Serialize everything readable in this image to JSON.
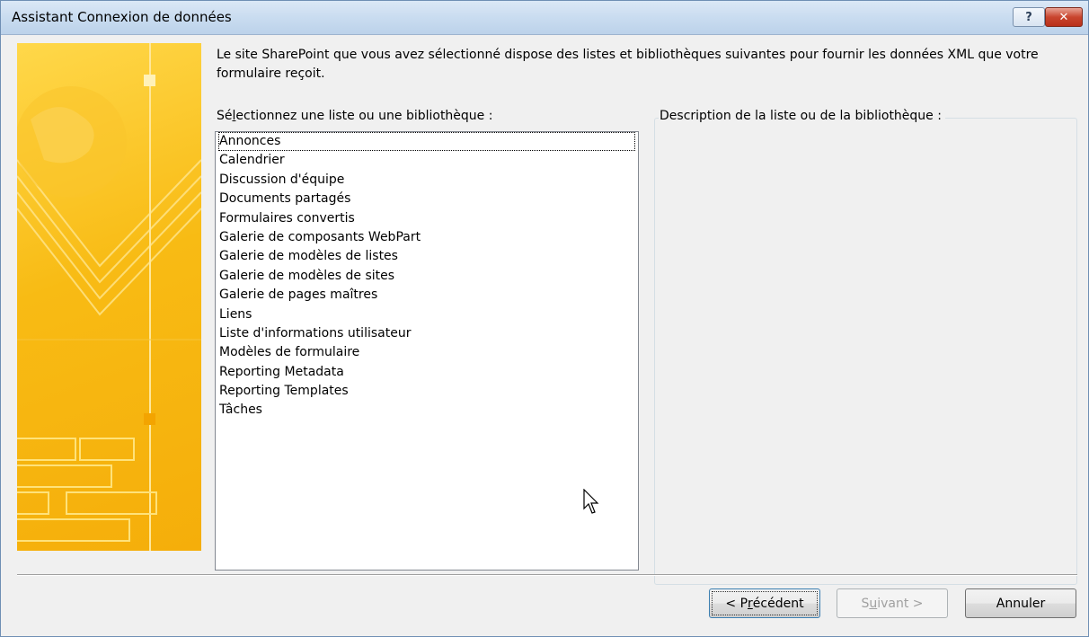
{
  "window": {
    "title": "Assistant Connexion de données",
    "help_label": "?",
    "close_label": "✕"
  },
  "intro_text": "Le site SharePoint que vous avez sélectionné dispose des listes et bibliothèques suivantes pour fournir les données XML que votre formulaire reçoit.",
  "list_section": {
    "label_prefix": "Sé",
    "label_accel": "l",
    "label_suffix": "ectionnez une liste ou une bibliothèque :",
    "items": [
      "Annonces",
      "Calendrier",
      "Discussion d'équipe",
      "Documents partagés",
      "Formulaires convertis",
      "Galerie de composants WebPart",
      "Galerie de modèles de listes",
      "Galerie de modèles de sites",
      "Galerie de pages maîtres",
      "Liens",
      "Liste d'informations utilisateur",
      "Modèles de formulaire",
      "Reporting Metadata",
      "Reporting Templates",
      "Tâches"
    ]
  },
  "description_section": {
    "label": "Description de la liste ou de la bibliothèque :"
  },
  "buttons": {
    "previous_prefix": "< P",
    "previous_accel": "r",
    "previous_suffix": "écédent",
    "next_prefix": "S",
    "next_accel": "u",
    "next_suffix": "ivant >",
    "cancel": "Annuler"
  },
  "colors": {
    "banner_yellow": "#f8bb14",
    "banner_light": "#ffe27a"
  }
}
